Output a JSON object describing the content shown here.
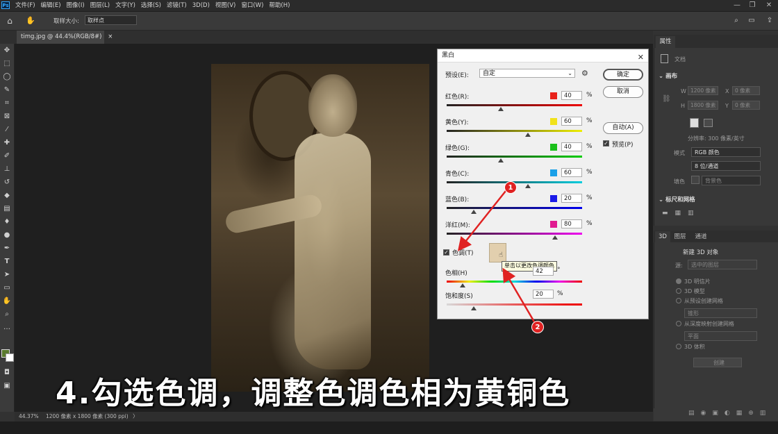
{
  "menubar": {
    "logo": "Ps",
    "items": [
      "文件(F)",
      "编辑(E)",
      "图像(I)",
      "图层(L)",
      "文字(Y)",
      "选择(S)",
      "滤镜(T)",
      "3D(D)",
      "视图(V)",
      "窗口(W)",
      "帮助(H)"
    ]
  },
  "options": {
    "sample_size_label": "取样大小:",
    "sample_size_value": "取样点"
  },
  "document": {
    "tab_title": "timg.jpg @ 44.4%(RGB/8#)",
    "tab_close": "×"
  },
  "statusbar": {
    "zoom": "44.37%",
    "info": "1200 像素 x 1800 像素 (300 ppi)",
    "arrow": "〉"
  },
  "dialog": {
    "title": "黑白",
    "close": "✕",
    "preset_label": "预设(E):",
    "preset_value": "自定",
    "ok": "确定",
    "cancel": "取消",
    "auto": "自动(A)",
    "preview": "预览(P)",
    "channels": [
      {
        "label": "红色(R):",
        "value": "40",
        "unit": "%",
        "color": "#e8221a",
        "level": 0.4
      },
      {
        "label": "黄色(Y):",
        "value": "60",
        "unit": "%",
        "color": "#f1e21b",
        "level": 0.6
      },
      {
        "label": "绿色(G):",
        "value": "40",
        "unit": "%",
        "color": "#1ac01a",
        "level": 0.4
      },
      {
        "label": "青色(C):",
        "value": "60",
        "unit": "%",
        "color": "#1aa0e8",
        "level": 0.6
      },
      {
        "label": "蓝色(B):",
        "value": "20",
        "unit": "%",
        "color": "#1a1ae8",
        "level": 0.2
      },
      {
        "label": "洋红(M):",
        "value": "80",
        "unit": "%",
        "color": "#e01a90",
        "level": 0.8
      }
    ],
    "tint_label": "色调(T)",
    "tint_color": "#e2cfae",
    "tooltip": "单击以更改色调颜色",
    "hue_label": "色相(H)",
    "hue_value": "42",
    "hue_unit": "°",
    "saturation_label": "饱和度(S)",
    "saturation_value": "20",
    "saturation_unit": "%",
    "markers": [
      "1",
      "2"
    ]
  },
  "properties": {
    "tab": "属性",
    "doc_label": "文档",
    "canvas_heading": "画布",
    "w_label": "W",
    "w_value": "1200 像素",
    "x_label": "X",
    "x_value": "0 像素",
    "h_label": "H",
    "h_value": "1800 像素",
    "y_label": "Y",
    "y_value": "0 像素",
    "resolution": "分辨率: 300 像素/英寸",
    "mode_label": "模式",
    "mode_value": "RGB 颜色",
    "depth_value": "8 位/通道",
    "fill_label": "填色",
    "fill_value": "背景色",
    "rulers_heading": "标尺和网格"
  },
  "panel3d": {
    "tabs": [
      "3D",
      "图层",
      "通道"
    ],
    "title": "新建 3D 对象",
    "source_label": "源:",
    "source_value": "选中的图层",
    "options": [
      "3D 明信片",
      "3D 模型",
      "从预设创建网格",
      "从深度映射创建网格",
      "3D 体积"
    ],
    "preset_value": "锥形",
    "depth_value": "平面",
    "create": "创建"
  },
  "subtitle": "4.勾选色调，调整色调色相为黄铜色"
}
